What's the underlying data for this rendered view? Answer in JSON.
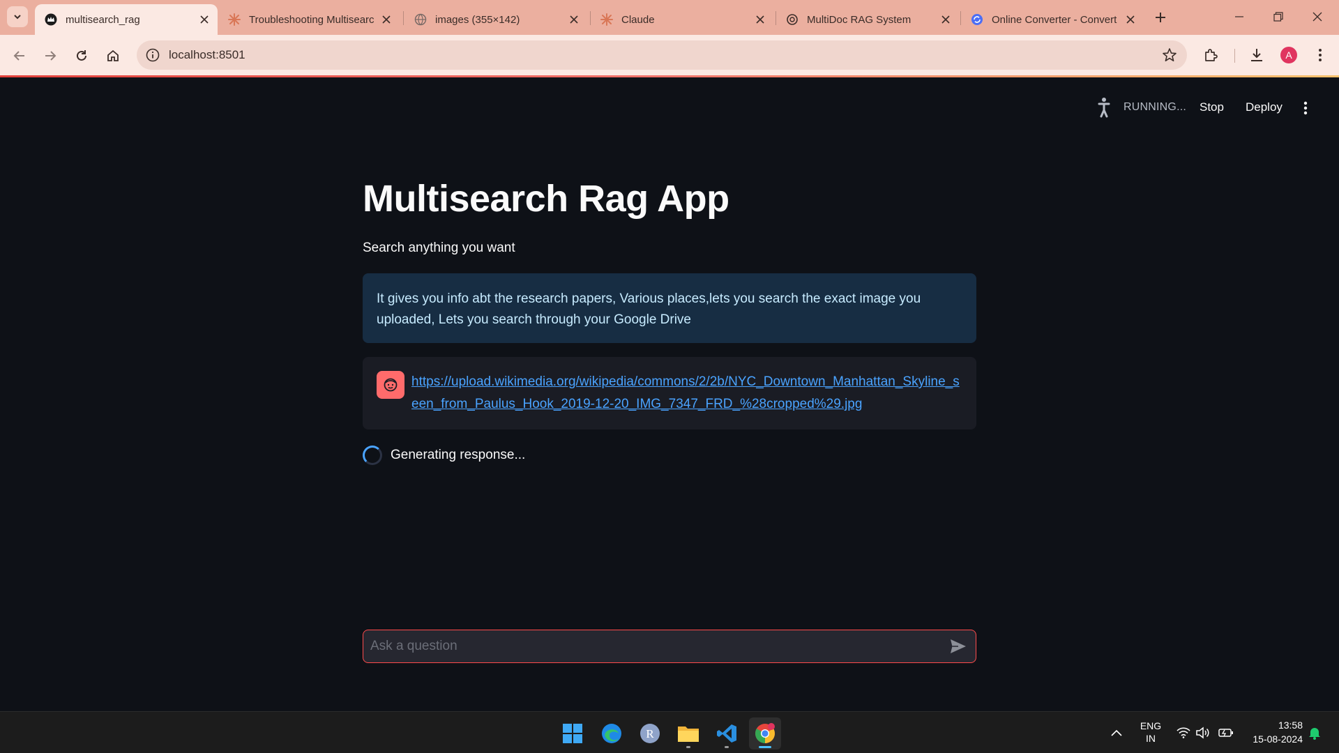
{
  "browser": {
    "tabs": [
      {
        "title": "multisearch_rag",
        "active": true,
        "icon": "streamlit-crown-icon"
      },
      {
        "title": "Troubleshooting Multisearch",
        "active": false,
        "icon": "claude-sunburst-icon"
      },
      {
        "title": "images (355×142)",
        "active": false,
        "icon": "globe-icon"
      },
      {
        "title": "Claude",
        "active": false,
        "icon": "claude-sunburst-icon"
      },
      {
        "title": "MultiDoc RAG System",
        "active": false,
        "icon": "chatgpt-icon"
      },
      {
        "title": "Online Converter - Convert",
        "active": false,
        "icon": "converter-icon"
      }
    ],
    "url": "localhost:8501",
    "profile_initial": "A"
  },
  "app_header": {
    "status": "RUNNING...",
    "stop_label": "Stop",
    "deploy_label": "Deploy"
  },
  "main": {
    "title": "Multisearch Rag App",
    "subtitle": "Search anything you want",
    "info": "It gives you info abt the research papers, Various places,lets you search the exact image you uploaded, Lets you search through your Google Drive",
    "message": {
      "link": "https://upload.wikimedia.org/wikipedia/commons/2/2b/NYC_Downtown_Manhattan_Skyline_seen_from_Paulus_Hook_2019-12-20_IMG_7347_FRD_%28cropped%29.jpg"
    },
    "spinner_text": "Generating response...",
    "chat_input": {
      "placeholder": "Ask a question",
      "value": ""
    }
  },
  "taskbar": {
    "apps": [
      "windows-start-icon",
      "edge-icon",
      "r-app-icon",
      "file-explorer-icon",
      "vscode-icon",
      "chrome-icon"
    ],
    "language": {
      "line1": "ENG",
      "line2": "IN"
    },
    "time": "13:58",
    "date": "15-08-2024"
  },
  "colors": {
    "tabstrip": "#ebaf9f",
    "toolbar": "#fbe9e3",
    "app_bg": "#0e1117",
    "info_bg": "#172d43",
    "info_text": "#c7ebff",
    "link": "#4aa3ff",
    "accent": "#ff4b4b",
    "avatar_bg": "#ff6b6b"
  }
}
